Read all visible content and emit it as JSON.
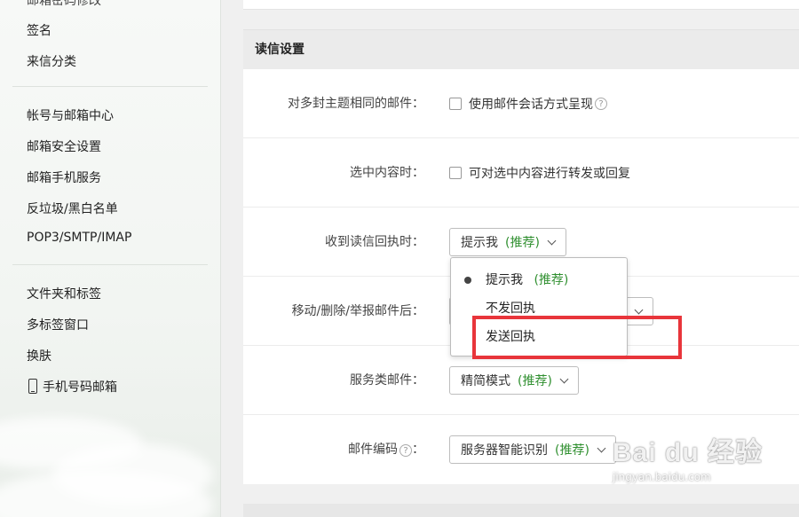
{
  "sidebar": {
    "partial_item": "邮箱密码修改",
    "group1": [
      "签名",
      "来信分类"
    ],
    "group2": [
      "帐号与邮箱中心",
      "邮箱安全设置",
      "邮箱手机服务",
      "反垃圾/黑白名单",
      "POP3/SMTP/IMAP"
    ],
    "group3": [
      "文件夹和标签",
      "多标签窗口",
      "换肤",
      "手机号码邮箱"
    ]
  },
  "panel": {
    "title": "读信设置",
    "rows": [
      {
        "label": "对多封主题相同的邮件：",
        "checkbox_label": "使用邮件会话方式呈现",
        "help": "?"
      },
      {
        "label": "选中内容时：",
        "checkbox_label": "可对选中内容进行转发或回复"
      },
      {
        "label": "收到读信回执时：",
        "select_value": "提示我",
        "select_rec": "(推荐)"
      },
      {
        "label": "移动/删除/举报邮件后："
      },
      {
        "label": "服务类邮件：",
        "select_value": "精简模式",
        "select_rec": "(推荐)"
      },
      {
        "label": "邮件编码",
        "help": "?",
        "colon": "：",
        "select_value": "服务器智能识别",
        "select_rec": "(推荐)"
      }
    ]
  },
  "dropdown": {
    "options": [
      {
        "label": "提示我",
        "rec": "(推荐)",
        "selected": true
      },
      {
        "label": "不发回执"
      },
      {
        "label": "发送回执"
      }
    ]
  },
  "watermark": {
    "brand": "Bai du 经验",
    "url": "jingyan.baidu.com"
  },
  "colors": {
    "recommend": "#2f8f2f",
    "highlight": "#e8353b"
  }
}
